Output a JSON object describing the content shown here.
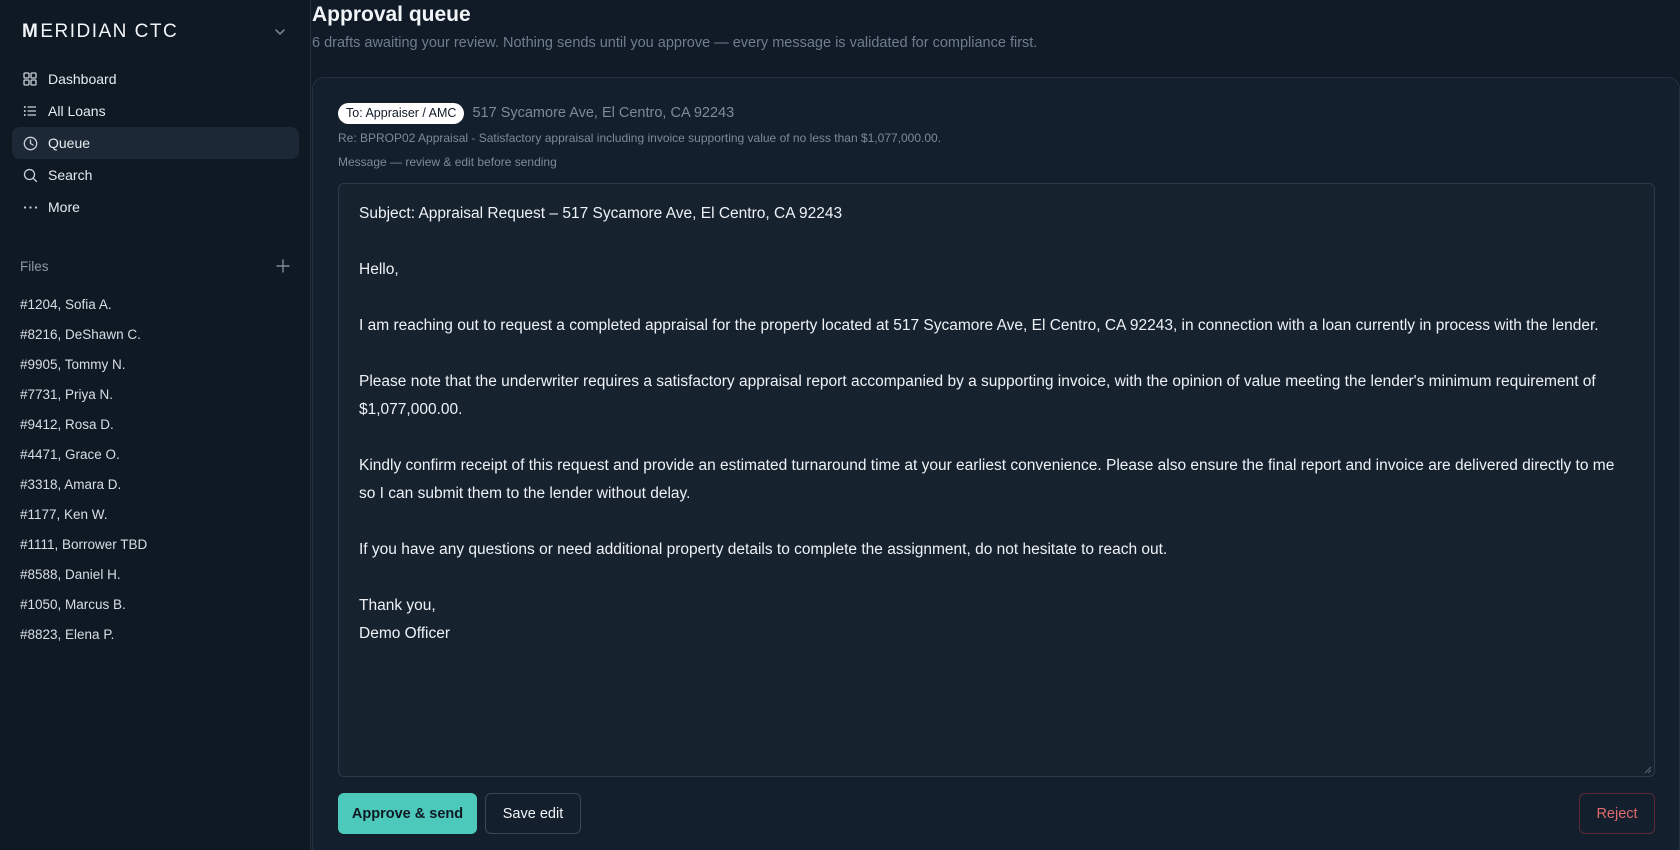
{
  "brand": {
    "logo_letter": "M",
    "name_rest": "ERIDIAN CTC"
  },
  "nav": [
    {
      "label": "Dashboard",
      "icon": "grid-icon",
      "active": false
    },
    {
      "label": "All Loans",
      "icon": "list-icon",
      "active": false
    },
    {
      "label": "Queue",
      "icon": "clock-icon",
      "active": true
    },
    {
      "label": "Search",
      "icon": "search-icon",
      "active": false
    },
    {
      "label": "More",
      "icon": "more-dots-icon",
      "active": false
    }
  ],
  "files": {
    "heading": "Files",
    "items": [
      "#1204, Sofia A.",
      "#8216, DeShawn C.",
      "#9905, Tommy N.",
      "#7731, Priya N.",
      "#9412, Rosa D.",
      "#4471, Grace O.",
      "#3318, Amara D.",
      "#1177, Ken W.",
      "#1111, Borrower TBD",
      "#8588, Daniel H.",
      "#1050, Marcus B.",
      "#8823, Elena P."
    ]
  },
  "header": {
    "title": "Approval queue",
    "subtitle": "6 drafts awaiting your review. Nothing sends until you approve — every message is validated for compliance first."
  },
  "draft": {
    "recipient": "To: Appraiser / AMC",
    "address": "517 Sycamore Ave, El Centro, CA 92243",
    "re_line": "Re: BPROP02 Appraisal - Satisfactory appraisal including invoice supporting value of no less than $1,077,000.00.",
    "message_label": "Message — review & edit before sending",
    "body": {
      "subject": "Subject: Appraisal Request – 517 Sycamore Ave, El Centro, CA 92243",
      "greeting": "Hello,",
      "p1": "I am reaching out to request a completed appraisal for the property located at 517 Sycamore Ave, El Centro, CA 92243, in connection with a loan currently in process with the lender.",
      "p2": "Please note that the underwriter requires a satisfactory appraisal report accompanied by a supporting invoice, with the opinion of value meeting the lender's minimum requirement of $1,077,000.00.",
      "p3": "Kindly confirm receipt of this request and provide an estimated turnaround time at your earliest convenience. Please also ensure the final report and invoice are delivered directly to me so I can submit them to the lender without delay.",
      "p4": "If you have any questions or need additional property details to complete the assignment, do not hesitate to reach out.",
      "closing": "Thank you,",
      "signature": "Demo Officer"
    }
  },
  "actions": {
    "approve_label": "Approve & send",
    "save_label": "Save edit",
    "reject_label": "Reject"
  },
  "colors": {
    "accent": "#4cc9bb",
    "danger": "#e06a6f",
    "background": "#111b27"
  }
}
